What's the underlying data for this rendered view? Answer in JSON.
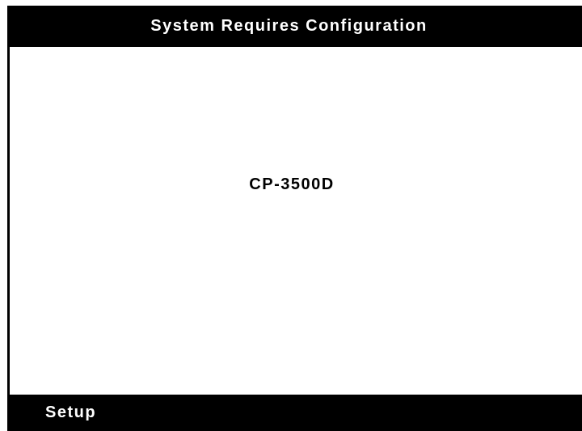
{
  "header": {
    "title": "System Requires Configuration"
  },
  "main": {
    "model_name": "CP-3500D"
  },
  "footer": {
    "softkey_label": "Setup"
  },
  "colors": {
    "background": "#000000",
    "content": "#ffffff",
    "text_on_dark": "#ffffff",
    "text_on_light": "#000000"
  }
}
